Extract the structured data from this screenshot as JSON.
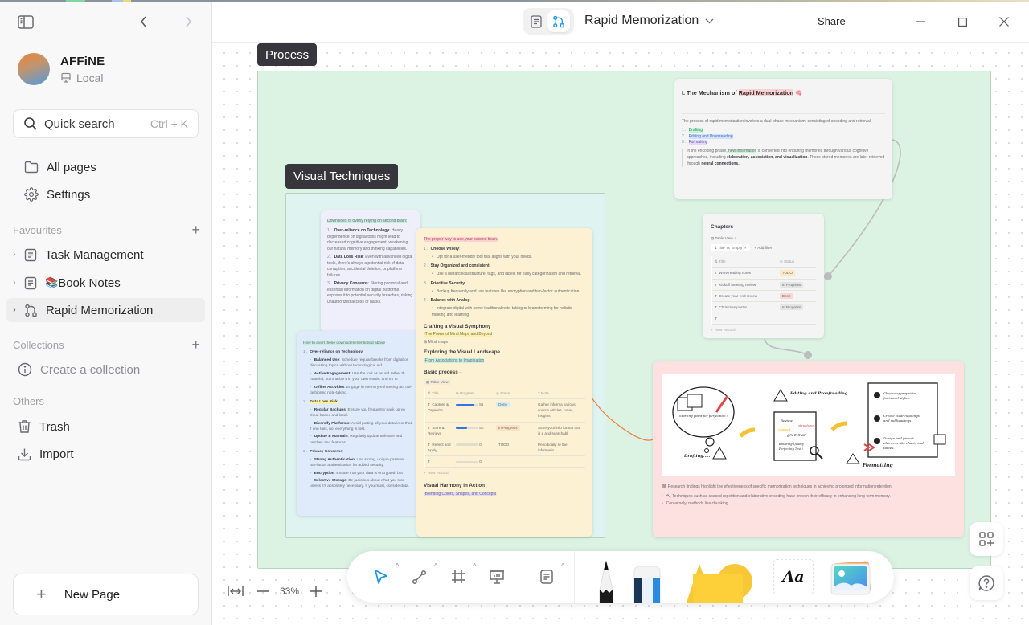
{
  "window": {
    "title": "Rapid Memorization",
    "share_label": "Share",
    "controls": [
      "minimize",
      "maximize",
      "close"
    ]
  },
  "sidebar": {
    "workspace_name": "AFFiNE",
    "workspace_type": "Local",
    "search_label": "Quick search",
    "search_shortcut": "Ctrl + K",
    "nav": [
      {
        "label": "All pages",
        "icon": "folder-icon"
      },
      {
        "label": "Settings",
        "icon": "gear-icon"
      }
    ],
    "favourites_header": "Favourites",
    "favourites": [
      {
        "label": "Task Management",
        "icon": "page-icon",
        "active": false
      },
      {
        "label": "Book Notes",
        "emoji": "📚",
        "icon": "page-icon",
        "active": false
      },
      {
        "label": "Rapid Memorization",
        "icon": "edgeless-icon",
        "active": true
      }
    ],
    "collections_header": "Collections",
    "create_collection": "Create a collection",
    "others_header": "Others",
    "others": [
      {
        "label": "Trash",
        "icon": "trash-icon"
      },
      {
        "label": "Import",
        "icon": "import-icon"
      }
    ],
    "new_page_label": "New Page"
  },
  "canvas": {
    "zoom_level": "33%",
    "frames": [
      {
        "label": "Process",
        "color": "#dcf3e4"
      },
      {
        "label": "Visual Techniques",
        "color": "#dff3f0"
      }
    ],
    "mechanism_note": {
      "heading_prefix": "I. The Mechanism of ",
      "heading_highlight": "Rapid Memorization",
      "heading_emoji": "🧠",
      "intro": "The process of rapid memorization involves a dual-phase mechanism, consisting of encoding and retrieval.",
      "steps": [
        "Drafting",
        "Editing and Proofreading",
        "Formatting"
      ],
      "quote_1": "In the encoding phase, ",
      "quote_highlight": "new information",
      "quote_2": " is converted into enduring memories through various cognitive approaches, including ",
      "quote_bold_1": "elaboration, association, and visualization",
      "quote_3": ". These stored memories are later retrieved through ",
      "quote_bold_2": "neural connections."
    },
    "chapters_note": {
      "title": "Chapters",
      "view": "Table View",
      "filter_field": "Title",
      "filter_op": "Is",
      "filter_value": "Empty",
      "add_filter": "Add filter",
      "columns": [
        "Title",
        "Status"
      ],
      "rows": [
        {
          "title": "Write reading notes",
          "status": "TODO"
        },
        {
          "title": "Kickoff meeting review",
          "status": "In Progress"
        },
        {
          "title": "Create year-end review",
          "status": "Done"
        },
        {
          "title": "Christmas poster",
          "status": "In Progress"
        },
        {
          "title": "",
          "status": ""
        }
      ],
      "new_record": "New Record"
    },
    "downsides_note": {
      "title": "Downsides of overly relying on second brain:",
      "items": [
        {
          "bold": "Over-reliance on Technology",
          "text": ": Heavy dependence on digital tools might lead to decreased cognitive engagement, weakening our natural memory and thinking capabilities."
        },
        {
          "bold": "Data Loss Risk",
          "text": ": Even with advanced digital tools, there's always a potential risk of data corruption, accidental deletion, or platform failures."
        },
        {
          "bold": "Privacy Concerns",
          "text": ": Storing personal and essential information on digital platforms exposes it to potential security breaches, risking unauthorized access or hacks."
        }
      ]
    },
    "avert_note": {
      "title": "How to avert these downsides mentioned above",
      "groups": [
        {
          "heading": "Over-reliance on Technology",
          "items": [
            {
              "bold": "Balanced Use",
              "text": ": Schedule regular breaks from digital or discussing topics without technological aid."
            },
            {
              "bold": "Active Engagement",
              "text": ": Use the tool as an aid rather th material, summarize it in your own words, and try to"
            },
            {
              "bold": "Offline Activities",
              "text": ": Engage in memory-enhancing act old-fashioned note-taking."
            }
          ]
        },
        {
          "heading": "Data Loss Risk",
          "items": [
            {
              "bold": "Regular Backups",
              "text": ": Ensure you frequently back up yo cloud-based and local."
            },
            {
              "bold": "Diversify Platforms",
              "text": ": Avoid putting all your data in or that if one fails, not everything is lost."
            },
            {
              "bold": "Update & Maintain",
              "text": ": Regularly update software and patches and features."
            }
          ]
        },
        {
          "heading": "Privacy Concerns",
          "items": [
            {
              "bold": "Strong Authentication",
              "text": ": Use strong, unique passwor two-factor authentication for added security."
            },
            {
              "bold": "Encryption",
              "text": ": Ensure that your data is encrypted, bot"
            },
            {
              "bold": "Selective Storage",
              "text": ": Be judicious about what you stor unless it's absolutely necessary. If you must, conside data."
            }
          ]
        }
      ]
    },
    "proper_way_note": {
      "title": "The proper way to use your second brain.",
      "items": [
        {
          "bold": "Choose Wisely",
          "sub": "Opt for a user-friendly tool that aligns with your needs."
        },
        {
          "bold": "Stay Organized and consistent",
          "sub": "Use a hierarchical structure, tags, and labels for easy categorization and retrieval."
        },
        {
          "bold": "Prioritize Security",
          "sub": "Backup frequently and use features like encryption and two-factor authentication."
        },
        {
          "bold": "Balance with Analog",
          "sub": "Integrate digital with some traditional note-taking or brainstorming for holistic thinking and learning."
        }
      ],
      "h_crafting": "Crafting a Visual Symphony",
      "sub_crafting": "-The Power of Mind Maps and Beyond",
      "mindmaps_link": "Mind maps",
      "h_exploring": "Exploring the Visual Landscape",
      "sub_exploring": "-From Associations to Imagination",
      "table_title": "Basic process",
      "table_view": "Table View",
      "columns": [
        "Title",
        "Progress",
        "Status",
        "Note"
      ],
      "rows": [
        {
          "title": "Capture & Organize",
          "progress": 81,
          "status": "Done",
          "note": "Gather informa various source articles, notes, insights."
        },
        {
          "title": "Store & Retrieve",
          "progress": 50,
          "status": "In Progress",
          "note": "Store your info format that is e and searchabl"
        },
        {
          "title": "Reflect and Apply",
          "progress": 0,
          "status": "TODO",
          "note": "Periodically re the informatio"
        },
        {
          "title": "",
          "progress": 0,
          "status": "",
          "note": ""
        }
      ],
      "new_record": "New Record",
      "h_harmony": "Visual Harmony in Action",
      "sub_harmony": "-Blending Colors, Shapes, and Concepts"
    },
    "research_note": {
      "illustration_labels": {
        "drafting": "Drafting.....",
        "starting_point": "Starting point for perfection !",
        "editing": "Editing and Proofreading",
        "review_words": [
          "Review",
          "structure",
          "content",
          "grammar",
          "Ensuring Quality Perfecting Text !"
        ],
        "formatting": "Formatting",
        "format_steps": [
          "Choose appropriate fonts and styles.",
          "Create clear headings and subheadings.",
          "Design and format elements like charts and tables."
        ]
      },
      "summary": "Research findings highlight the effectiveness of specific memorization techniques in achieving prolonged information retention.",
      "bullets": [
        "Techniques such as spaced repetition and elaborative encoding have proven their efficacy in enhancing long-term memory.",
        "Conversely, methods like chunking..."
      ]
    }
  },
  "toolbar": {
    "tools": [
      "select",
      "connector",
      "frame",
      "presentation",
      "note"
    ],
    "text_tool_label": "Aa"
  }
}
